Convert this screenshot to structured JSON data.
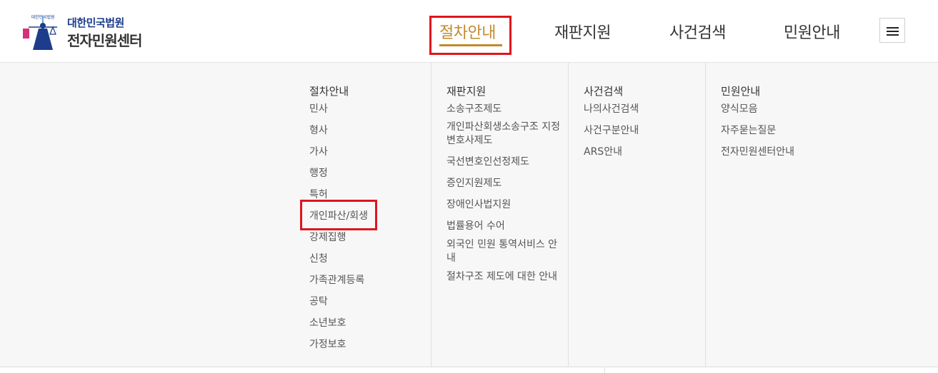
{
  "header": {
    "logo": {
      "line1": "대한민국법원",
      "line2": "전자민원센터",
      "emblem_text": "대한민국법원"
    },
    "nav": [
      {
        "label": "절차안내",
        "active": true
      },
      {
        "label": "재판지원",
        "active": false
      },
      {
        "label": "사건검색",
        "active": false
      },
      {
        "label": "민원안내",
        "active": false
      }
    ],
    "menu_icon": "hamburger-icon"
  },
  "mega_menu": {
    "columns": [
      {
        "title": "절차안내",
        "items": [
          "민사",
          "형사",
          "가사",
          "행정",
          "특허",
          "개인파산/회생",
          "강제집행",
          "신청",
          "가족관계등록",
          "공탁",
          "소년보호",
          "가정보호"
        ]
      },
      {
        "title": "재판지원",
        "items": [
          "소송구조제도",
          "개인파산회생소송구조 지정변호사제도",
          "국선변호인선정제도",
          "증인지원제도",
          "장애인사법지원",
          "법률용어 수어",
          "외국인 민원 통역서비스 안내",
          "절차구조 제도에 대한 안내"
        ]
      },
      {
        "title": "사건검색",
        "items": [
          "나의사건검색",
          "사건구분안내",
          "ARS안내"
        ]
      },
      {
        "title": "민원안내",
        "items": [
          "양식모음",
          "자주묻는질문",
          "전자민원센터안내"
        ]
      }
    ]
  },
  "colors": {
    "accent": "#c28a2c",
    "highlight": "#e0141e",
    "brand_blue": "#1d3c8c"
  }
}
